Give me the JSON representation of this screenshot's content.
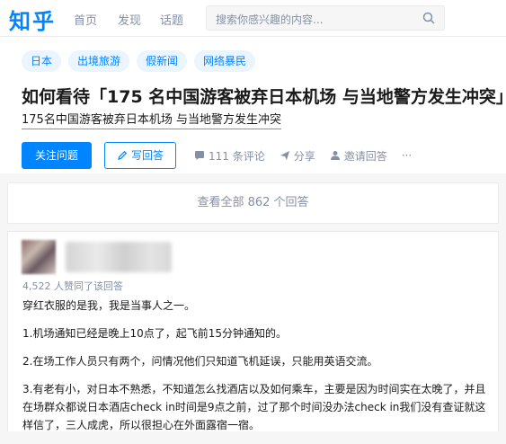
{
  "header": {
    "logo": "知乎",
    "nav": [
      "首页",
      "发现",
      "话题"
    ],
    "search_placeholder": "搜索你感兴趣的内容..."
  },
  "question": {
    "tags": [
      "日本",
      "出境旅游",
      "假新闻",
      "网络暴民"
    ],
    "title": "如何看待「175 名中国游客被弃日本机场 与当地警方发生冲突」？",
    "detail": "175名中国游客被弃日本机场 与当地警方发生冲突",
    "follow_label": "关注问题",
    "write_label": "写回答",
    "comments_label": "111 条评论",
    "share_label": "分享",
    "invite_label": "邀请回答",
    "more_label": "···"
  },
  "view_all_label": "查看全部 862 个回答",
  "answer": {
    "votes": "4,522 人赞同了该回答",
    "paragraphs": [
      "穿红衣服的是我，我是当事人之一。",
      "1.机场通知已经是晚上10点了，起飞前15分钟通知的。",
      "2.在场工作人员只有两个，问情况他们只知道飞机延误，只能用英语交流。",
      "3.有老有小，对日本不熟悉，不知道怎么找酒店以及如何乘车，主要是因为时间实在太晚了，并且在场群众都说日本酒店check in时间是9点之前，过了那个时间没办法check in我们没有查证就这样信了，三人成虎，所以很担心在外面露宿一宿。"
    ]
  },
  "colors": {
    "brand": "#0084ff",
    "tag_bg": "#ebf5ff",
    "muted": "#8590a6",
    "page_bg": "#f6f6f6"
  }
}
